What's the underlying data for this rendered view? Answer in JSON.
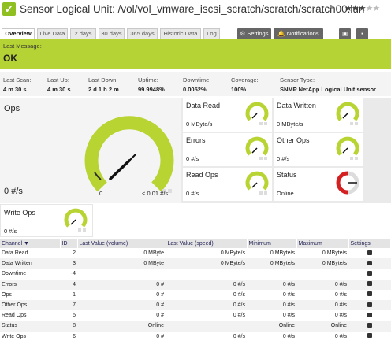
{
  "header": {
    "title": "Sensor Logical Unit: /vol/vol_vmware_iscsi_scratch/scratch/scratch00.lun",
    "stars_on": "★★★",
    "stars_off": "★★"
  },
  "tabs": [
    "Overview",
    "Live Data",
    "2 days",
    "30 days",
    "365 days",
    "Historic Data",
    "Log"
  ],
  "toolbar": {
    "settings": "⚙ Settings",
    "notifications": "🔔 Notifications"
  },
  "message": {
    "label": "Last Message:",
    "value": "OK",
    "color": "#b5d334"
  },
  "stats": [
    {
      "label": "Last Scan:",
      "value": "4 m 30 s"
    },
    {
      "label": "Last Up:",
      "value": "4 m 30 s"
    },
    {
      "label": "Last Down:",
      "value": "2 d 1 h 2 m"
    },
    {
      "label": "Uptime:",
      "value": "99.9948%"
    },
    {
      "label": "Downtime:",
      "value": "0.0052%"
    },
    {
      "label": "Coverage:",
      "value": "100%"
    },
    {
      "label": "Sensor Type:",
      "value": "SNMP NetApp Logical Unit sensor"
    }
  ],
  "big_gauge": {
    "name": "Ops",
    "value": "0 #/s",
    "min_label": "0",
    "max_label": "< 0.01 #/s",
    "level": 0
  },
  "small_gauges": [
    {
      "name": "Data Read",
      "value": "0 MByte/s"
    },
    {
      "name": "Data Written",
      "value": "0 MByte/s"
    },
    {
      "name": "Errors",
      "value": "0 #/s"
    },
    {
      "name": "Other Ops",
      "value": "0 #/s"
    },
    {
      "name": "Read Ops",
      "value": "0 #/s"
    },
    {
      "name": "Status",
      "value": "Online"
    }
  ],
  "write_ops": {
    "name": "Write Ops",
    "value": "0 #/s"
  },
  "table": {
    "headers": [
      "Channel ▼",
      "ID",
      "Last Value (volume)",
      "Last Value (speed)",
      "Minimum",
      "Maximum",
      "Settings"
    ],
    "rows": [
      [
        "Data Read",
        "2",
        "0 MByte",
        "0 MByte/s",
        "0 MByte/s",
        "0 MByte/s"
      ],
      [
        "Data Written",
        "3",
        "0 MByte",
        "0 MByte/s",
        "0 MByte/s",
        "0 MByte/s"
      ],
      [
        "Downtime",
        "-4",
        "",
        "",
        "",
        ""
      ],
      [
        "Errors",
        "4",
        "0 #",
        "0 #/s",
        "0 #/s",
        "0 #/s"
      ],
      [
        "Ops",
        "1",
        "0 #",
        "0 #/s",
        "0 #/s",
        "0 #/s"
      ],
      [
        "Other Ops",
        "7",
        "0 #",
        "0 #/s",
        "0 #/s",
        "0 #/s"
      ],
      [
        "Read Ops",
        "5",
        "0 #",
        "0 #/s",
        "0 #/s",
        "0 #/s"
      ],
      [
        "Status",
        "8",
        "Online",
        "",
        "Online",
        "Online"
      ],
      [
        "Write Ops",
        "6",
        "0 #",
        "0 #/s",
        "0 #/s",
        "0 #/s"
      ]
    ]
  },
  "colors": {
    "ok_green": "#8fbf20",
    "gauge_green": "#b8d432",
    "status_red": "#d42020"
  }
}
